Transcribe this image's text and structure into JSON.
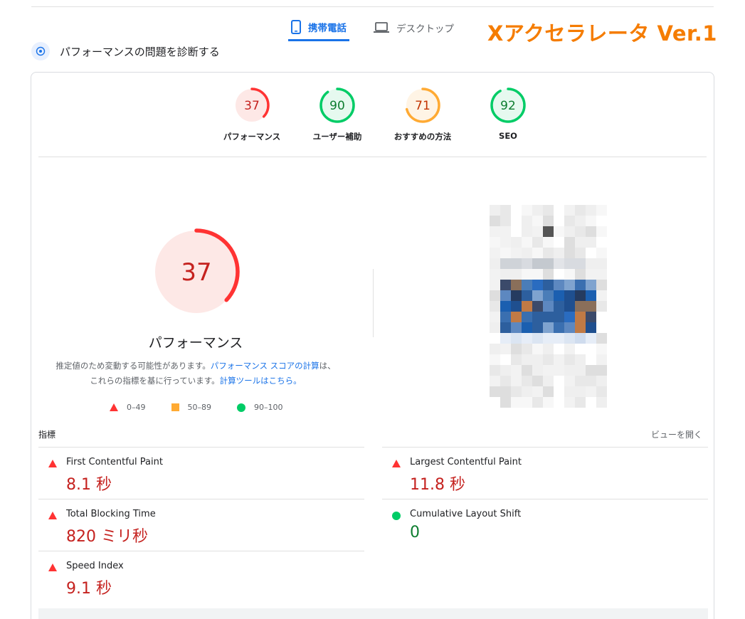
{
  "tabs": [
    {
      "label": "携帯電話",
      "icon": "smartphone-icon",
      "active": true
    },
    {
      "label": "デスクトップ",
      "icon": "laptop-icon",
      "active": false
    }
  ],
  "brand": "Xアクセラレータ Ver.1",
  "diagnose_title": "パフォーマンスの問題を診断する",
  "categories": [
    {
      "label": "パフォーマンス",
      "score": "37",
      "value": 37,
      "rating": "fail"
    },
    {
      "label": "ユーザー補助",
      "score": "90",
      "value": 90,
      "rating": "pass"
    },
    {
      "label": "おすすめの方法",
      "score": "71",
      "value": 71,
      "rating": "average"
    },
    {
      "label": "SEO",
      "score": "92",
      "value": 92,
      "rating": "pass"
    }
  ],
  "main_gauge": {
    "score": "37",
    "value": 37,
    "title": "パフォーマンス"
  },
  "description": {
    "text1": "推定値のため変動する可能性があります。",
    "link1": "パフォーマンス スコアの計算",
    "text2": "は、これらの指標を基に行っています。",
    "link2": "計算ツールはこちら。"
  },
  "legend": [
    {
      "shape": "triangle",
      "label": "0–49",
      "color": "#ff3333"
    },
    {
      "shape": "square",
      "label": "50–89",
      "color": "#ffaa33"
    },
    {
      "shape": "circle",
      "label": "90–100",
      "color": "#00cc66"
    }
  ],
  "metrics_label": "指標",
  "expand_label": "ビューを開く",
  "metrics": [
    {
      "name": "First Contentful Paint",
      "value": "8.1 秒",
      "rating": "fail"
    },
    {
      "name": "Largest Contentful Paint",
      "value": "11.8 秒",
      "rating": "fail"
    },
    {
      "name": "Total Blocking Time",
      "value": "820 ミリ秒",
      "rating": "fail"
    },
    {
      "name": "Cumulative Layout Shift",
      "value": "0",
      "rating": "pass"
    },
    {
      "name": "Speed Index",
      "value": "9.1 秒",
      "rating": "fail"
    }
  ],
  "colors": {
    "fail": "#ff3333",
    "fail_bg": "#fde8e6",
    "fail_text": "#c5221f",
    "average": "#ffaa33",
    "average_bg": "#fff4e5",
    "average_text": "#c33300",
    "pass": "#00cc66",
    "pass_bg": "#e6f9ef",
    "pass_text": "#0d7d2f",
    "brand": "#f57c00",
    "link": "#1a73e8"
  }
}
